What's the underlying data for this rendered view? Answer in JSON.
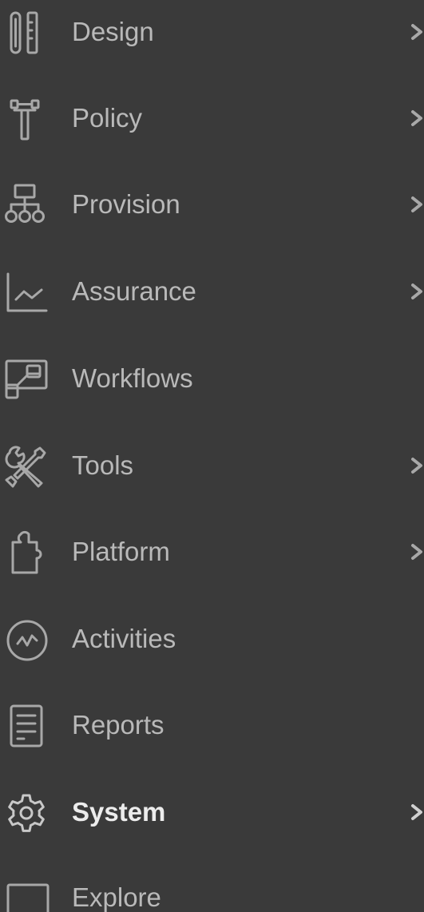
{
  "colors": {
    "background": "#3a3a3a",
    "label": "#b9b9b9",
    "label_active": "#ececec",
    "icon": "#a8a8a8"
  },
  "menu": {
    "items": [
      {
        "label": "Design",
        "icon": "design-icon",
        "has_submenu": true
      },
      {
        "label": "Policy",
        "icon": "policy-icon",
        "has_submenu": true
      },
      {
        "label": "Provision",
        "icon": "provision-icon",
        "has_submenu": true
      },
      {
        "label": "Assurance",
        "icon": "assurance-icon",
        "has_submenu": true
      },
      {
        "label": "Workflows",
        "icon": "workflows-icon",
        "has_submenu": false
      },
      {
        "label": "Tools",
        "icon": "tools-icon",
        "has_submenu": true
      },
      {
        "label": "Platform",
        "icon": "platform-icon",
        "has_submenu": true
      },
      {
        "label": "Activities",
        "icon": "activities-icon",
        "has_submenu": false
      },
      {
        "label": "Reports",
        "icon": "reports-icon",
        "has_submenu": false
      },
      {
        "label": "System",
        "icon": "gear-icon",
        "has_submenu": true,
        "active": true
      },
      {
        "label": "Explore",
        "icon": "monitor-icon",
        "has_submenu": false
      }
    ]
  }
}
